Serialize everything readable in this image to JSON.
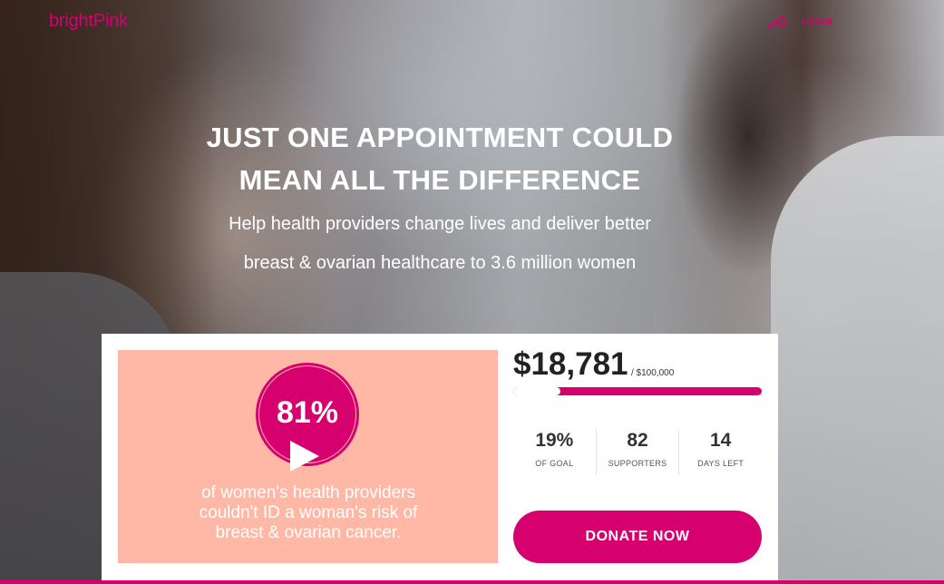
{
  "header": {
    "logo_part1": "bright",
    "logo_part2": "Pink",
    "login_icon": "share-arrow-icon",
    "login_label": "LOGIN"
  },
  "hero": {
    "headline_line1": "JUST ONE APPOINTMENT COULD",
    "headline_line2": "MEAN ALL THE DIFFERENCE",
    "subtitle_line1": "Help health providers change lives and deliver better",
    "subtitle_line2": "breast & ovarian healthcare to 3.6 million women"
  },
  "video": {
    "stat": "81%",
    "caption_line1": "of women's health providers",
    "caption_line2": "couldn't ID a woman's risk of",
    "caption_line3": "breast & ovarian cancer.",
    "play_icon": "play-icon"
  },
  "campaign": {
    "raised": "$18,781",
    "goal": "/ $100,000",
    "progress_fraction": 0.19,
    "stats": [
      {
        "value": "19%",
        "label": "OF GOAL"
      },
      {
        "value": "82",
        "label": "SUPPORTERS"
      },
      {
        "value": "14",
        "label": "DAYS LEFT"
      }
    ],
    "donate_label": "DONATE NOW"
  },
  "colors": {
    "brand": "#d6006f",
    "video_bg": "#ffb8a6"
  }
}
